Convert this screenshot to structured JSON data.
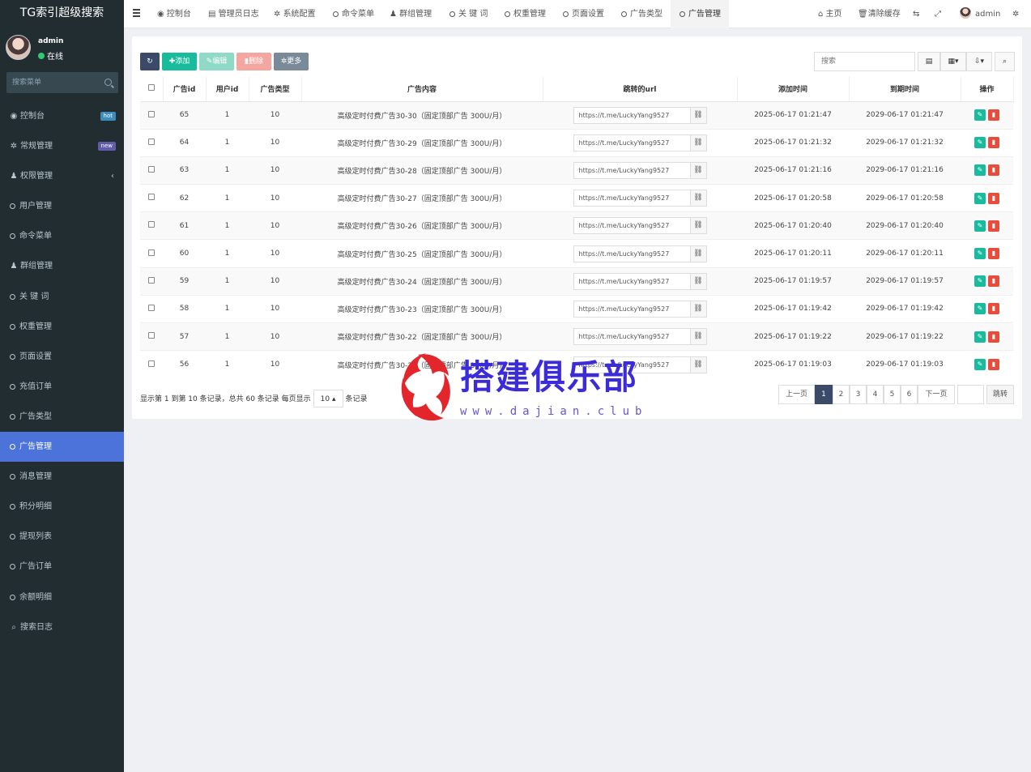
{
  "app": {
    "title": "TG索引超级搜索"
  },
  "user": {
    "name": "admin",
    "status": "在线"
  },
  "sidebar": {
    "search_placeholder": "搜索菜单",
    "items": [
      {
        "label": "控制台",
        "badge": "hot"
      },
      {
        "label": "常规管理",
        "badge": "new"
      },
      {
        "label": "权限管理"
      },
      {
        "label": "用户管理"
      },
      {
        "label": "命令菜单"
      },
      {
        "label": "群组管理"
      },
      {
        "label": "关 键 词"
      },
      {
        "label": "权重管理"
      },
      {
        "label": "页面设置"
      },
      {
        "label": "充值订单"
      },
      {
        "label": "广告类型"
      },
      {
        "label": "广告管理"
      },
      {
        "label": "消息管理"
      },
      {
        "label": "积分明细"
      },
      {
        "label": "提现列表"
      },
      {
        "label": "广告订单"
      },
      {
        "label": "余额明细"
      },
      {
        "label": "搜索日志"
      }
    ]
  },
  "topnav": {
    "tabs": [
      "控制台",
      "管理员日志",
      "系统配置",
      "命令菜单",
      "群组管理",
      "关 键 词",
      "权重管理",
      "页面设置",
      "广告类型",
      "广告管理"
    ],
    "home": "主页",
    "clear_cache": "清除缓存",
    "user": "admin"
  },
  "toolbar": {
    "add": "添加",
    "edit": "编辑",
    "delete": "删除",
    "more": "更多",
    "search_placeholder": "搜索"
  },
  "table": {
    "headers": [
      "广告id",
      "用户id",
      "广告类型",
      "广告内容",
      "跳转的url",
      "添加时间",
      "到期时间",
      "操作"
    ],
    "rows": [
      {
        "id": "65",
        "uid": "1",
        "type": "10",
        "content": "高级定时付费广告30-30（固定顶部广告 300U/月）",
        "url": "https://t.me/LuckyYang9527",
        "add": "2025-06-17 01:21:47",
        "expire": "2029-06-17 01:21:47"
      },
      {
        "id": "64",
        "uid": "1",
        "type": "10",
        "content": "高级定时付费广告30-29（固定顶部广告 300U/月）",
        "url": "https://t.me/LuckyYang9527",
        "add": "2025-06-17 01:21:32",
        "expire": "2029-06-17 01:21:32"
      },
      {
        "id": "63",
        "uid": "1",
        "type": "10",
        "content": "高级定时付费广告30-28（固定顶部广告 300U/月）",
        "url": "https://t.me/LuckyYang9527",
        "add": "2025-06-17 01:21:16",
        "expire": "2029-06-17 01:21:16"
      },
      {
        "id": "62",
        "uid": "1",
        "type": "10",
        "content": "高级定时付费广告30-27（固定顶部广告 300U/月）",
        "url": "https://t.me/LuckyYang9527",
        "add": "2025-06-17 01:20:58",
        "expire": "2029-06-17 01:20:58"
      },
      {
        "id": "61",
        "uid": "1",
        "type": "10",
        "content": "高级定时付费广告30-26（固定顶部广告 300U/月）",
        "url": "https://t.me/LuckyYang9527",
        "add": "2025-06-17 01:20:40",
        "expire": "2029-06-17 01:20:40"
      },
      {
        "id": "60",
        "uid": "1",
        "type": "10",
        "content": "高级定时付费广告30-25（固定顶部广告 300U/月）",
        "url": "https://t.me/LuckyYang9527",
        "add": "2025-06-17 01:20:11",
        "expire": "2029-06-17 01:20:11"
      },
      {
        "id": "59",
        "uid": "1",
        "type": "10",
        "content": "高级定时付费广告30-24（固定顶部广告 300U/月）",
        "url": "https://t.me/LuckyYang9527",
        "add": "2025-06-17 01:19:57",
        "expire": "2029-06-17 01:19:57"
      },
      {
        "id": "58",
        "uid": "1",
        "type": "10",
        "content": "高级定时付费广告30-23（固定顶部广告 300U/月）",
        "url": "https://t.me/LuckyYang9527",
        "add": "2025-06-17 01:19:42",
        "expire": "2029-06-17 01:19:42"
      },
      {
        "id": "57",
        "uid": "1",
        "type": "10",
        "content": "高级定时付费广告30-22（固定顶部广告 300U/月）",
        "url": "https://t.me/LuckyYang9527",
        "add": "2025-06-17 01:19:22",
        "expire": "2029-06-17 01:19:22"
      },
      {
        "id": "56",
        "uid": "1",
        "type": "10",
        "content": "高级定时付费广告30-21（固定顶部广告 300U/月）",
        "url": "https://t.me/LuckyYang9527",
        "add": "2025-06-17 01:19:03",
        "expire": "2029-06-17 01:19:03"
      }
    ]
  },
  "footer": {
    "info_prefix": "显示第 1 到第 10 条记录，总共 60 条记录 每页显示",
    "page_size": "10",
    "info_suffix": "条记录",
    "prev": "上一页",
    "next": "下一页",
    "pages": [
      "1",
      "2",
      "3",
      "4",
      "5",
      "6"
    ],
    "jump": "跳转"
  },
  "watermark": {
    "text": "搭建俱乐部",
    "url": "www.dajian.club"
  },
  "colors": {
    "sidebar": "#222d32",
    "active": "#4b73d9",
    "success": "#18bc9c",
    "danger": "#e74c3c",
    "primary_dark": "#3a4a68"
  }
}
